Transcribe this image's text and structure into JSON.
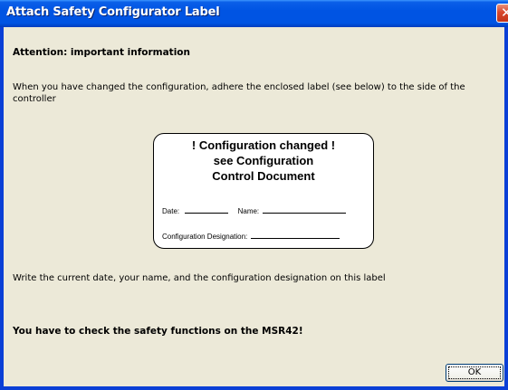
{
  "window": {
    "title": "Attach Safety Configurator Label",
    "close_symbol": "✕",
    "close_icon": "close-icon"
  },
  "content": {
    "heading": "Attention: important information",
    "instruction": "When you have changed the configuration, adhere the enclosed label (see below) to the side of the controller",
    "write_text": "Write the current date, your name, and the configuration designation on this label",
    "warning": "You have to check the safety functions on the MSR42!"
  },
  "label": {
    "headline": "! Configuration changed !\nsee Configuration\nControl Document",
    "date_label": "Date:",
    "name_label": "Name:",
    "designation_label": "Configuration Designation:"
  },
  "buttons": {
    "ok": "OK"
  },
  "colors": {
    "titlebar": "#0054e3",
    "dialog_bg": "#ece9d8",
    "close": "#d8472b"
  }
}
